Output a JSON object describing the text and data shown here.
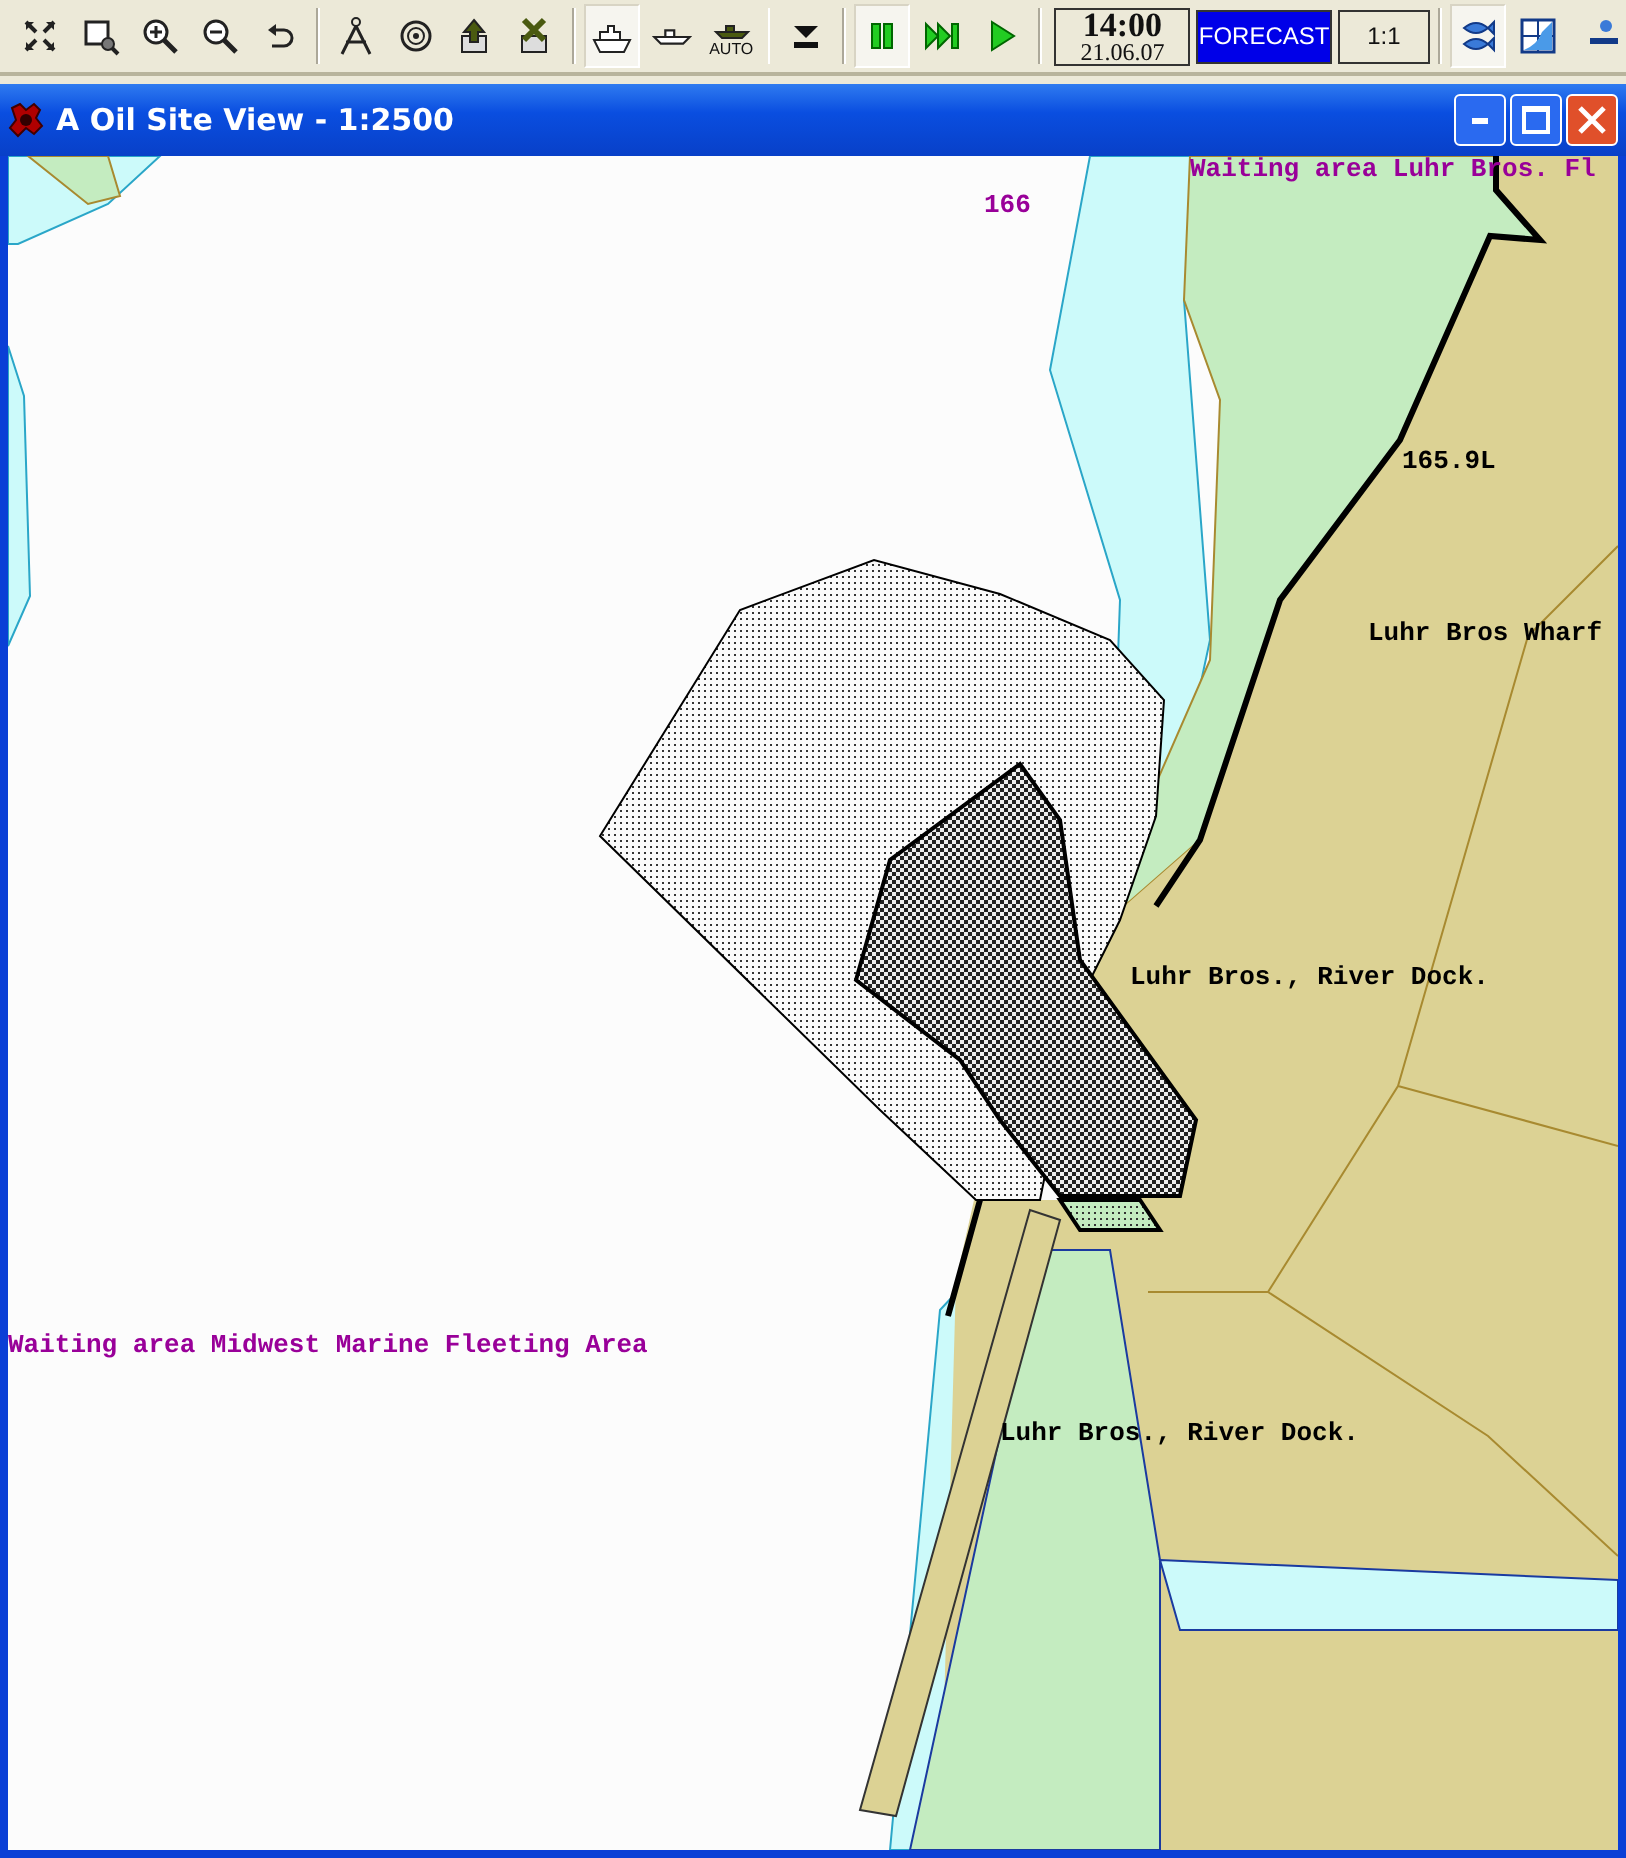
{
  "toolbar": {
    "groups": [
      [
        {
          "kind": "fit",
          "pressed": false
        },
        {
          "kind": "zoom-rect",
          "pressed": false
        },
        {
          "kind": "zoom-in",
          "pressed": false
        },
        {
          "kind": "zoom-out",
          "pressed": false
        },
        {
          "kind": "undo",
          "pressed": false
        }
      ],
      [
        {
          "kind": "compass",
          "pressed": false
        },
        {
          "kind": "target",
          "pressed": false
        },
        {
          "kind": "export",
          "pressed": false
        },
        {
          "kind": "delete",
          "pressed": false
        }
      ],
      [
        {
          "kind": "ship-large",
          "pressed": true
        },
        {
          "kind": "ship-small",
          "pressed": false
        },
        {
          "kind": "ship-auto",
          "pressed": false,
          "label": "AUTO"
        }
      ],
      [
        {
          "kind": "drop",
          "pressed": false
        }
      ],
      [
        {
          "kind": "pause",
          "pressed": true
        },
        {
          "kind": "fast-forward",
          "pressed": false
        },
        {
          "kind": "play",
          "pressed": false
        }
      ]
    ],
    "clock": {
      "time": "14:00",
      "date": "21.06.07"
    },
    "forecast": "FORECAST",
    "scale": "1:1",
    "right_buttons": [
      {
        "kind": "fish",
        "pressed": true
      },
      {
        "kind": "chart",
        "pressed": false
      },
      {
        "kind": "edge",
        "pressed": false
      }
    ]
  },
  "window": {
    "title": "A Oil Site View - 1:2500"
  },
  "map": {
    "labels": [
      {
        "text": "Waiting area Luhr Bros. Fl",
        "color": "#990099"
      },
      {
        "text": "166",
        "color": "#990099"
      },
      {
        "text": "165.9L",
        "color": "#000000"
      },
      {
        "text": "Luhr Bros Wharf",
        "color": "#000000"
      },
      {
        "text": "Luhr Bros., River Dock.",
        "color": "#000000"
      },
      {
        "text": "Waiting area Midwest Marine Fleeting Area",
        "color": "#990099"
      },
      {
        "text": "Luhr Bros., River Dock.",
        "color": "#000000"
      }
    ]
  }
}
